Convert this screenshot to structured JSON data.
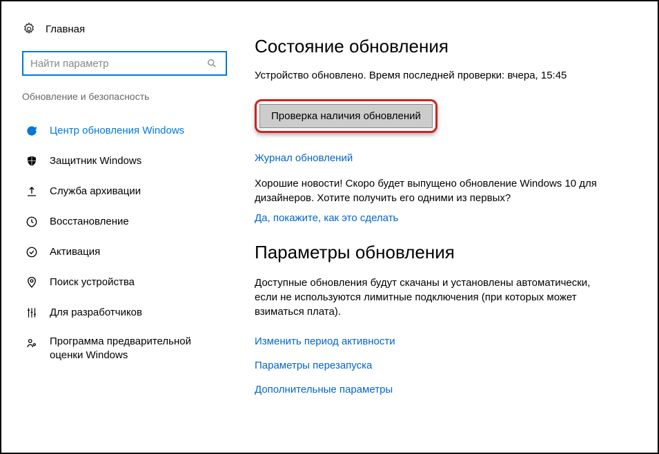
{
  "sidebar": {
    "home_label": "Главная",
    "search_placeholder": "Найти параметр",
    "section_label": "Обновление и безопасность",
    "items": [
      {
        "label": "Центр обновления Windows",
        "active": true
      },
      {
        "label": "Защитник Windows"
      },
      {
        "label": "Служба архивации"
      },
      {
        "label": "Восстановление"
      },
      {
        "label": "Активация"
      },
      {
        "label": "Поиск устройства"
      },
      {
        "label": "Для разработчиков"
      },
      {
        "label": "Программа предварительной оценки Windows"
      }
    ]
  },
  "main": {
    "status_heading": "Состояние обновления",
    "status_text": "Устройство обновлено. Время последней проверки: вчера, 15:45",
    "check_button": "Проверка наличия обновлений",
    "history_link": "Журнал обновлений",
    "news_text": "Хорошие новости! Скоро будет выпущено обновление Windows 10 для дизайнеров. Хотите получить его одними из первых?",
    "news_link": "Да, покажите, как это сделать",
    "params_heading": "Параметры обновления",
    "params_text": "Доступные обновления будут скачаны и установлены автоматически, если не используются лимитные подключения (при которых может взиматься плата).",
    "active_hours_link": "Изменить период активности",
    "restart_link": "Параметры перезапуска",
    "advanced_link": "Дополнительные параметры"
  }
}
